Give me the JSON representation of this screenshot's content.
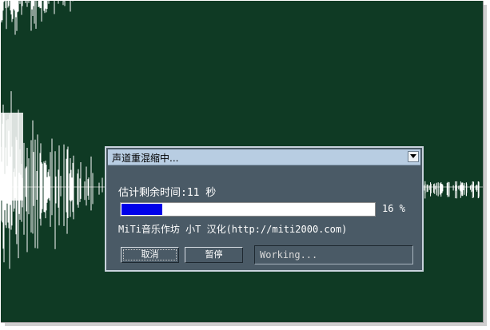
{
  "dialog": {
    "title": "声道重混缩中...",
    "time_label": "估计剩余时间:11 秒",
    "progress_value": 16,
    "progress_percent_text": "16 %",
    "credit_text": "MiTi音乐作坊 小T 汉化(http://miti2000.com)",
    "cancel_label": "取消",
    "pause_label": "暂停",
    "status_text": "Working...",
    "dropdown_icon": "chevron-down-icon"
  },
  "colors": {
    "background": "#0f3a24",
    "waveform": "#ffffff",
    "dialog_body": "#4a5a66",
    "titlebar": "#b8cde2",
    "progress_fill": "#0000e8"
  }
}
